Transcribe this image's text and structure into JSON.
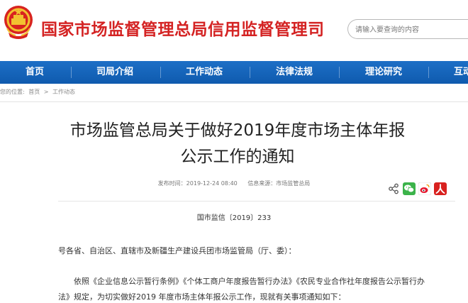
{
  "header": {
    "site_title": "国家市场监督管理总局信用监督管理司",
    "emblem_icon": "national-emblem-icon",
    "search": {
      "placeholder": "请输入要查询的内容"
    }
  },
  "nav": {
    "items": [
      {
        "label": "首页"
      },
      {
        "label": "司局介绍"
      },
      {
        "label": "工作动态"
      },
      {
        "label": "法律法规"
      },
      {
        "label": "理论研究"
      },
      {
        "label": "互动"
      }
    ],
    "background": "#1665bd"
  },
  "breadcrumb": {
    "prefix": "您的位置:",
    "items": [
      "首页",
      "工作动态"
    ],
    "separator": ">"
  },
  "article": {
    "title_line1": "市场监管总局关于做好2019年度市场主体年报",
    "title_line2": "公示工作的通知",
    "publish_time": "发布时间：2019-12-24 08:40",
    "source": "信息来源：市场监管总局",
    "share_icons": [
      "share-icon",
      "wechat-icon",
      "weibo-icon",
      "renren-icon"
    ],
    "doc_number": "国市监信〔2019〕233",
    "recipients": "号各省、自治区、直辖市及新疆生产建设兵团市场监管局（厅、委）：",
    "body_line1": "依照《企业信息公示暂行条例》《个体工商户年度报告暂行办法》《农民专业合作社年度报告公示暂行办",
    "body_line2": "法》规定，为切实做好2019 年度市场主体年报公示工作，现就有关事项通知如下："
  },
  "colors": {
    "title_red": "#d42323",
    "nav_blue": "#1665bd",
    "wechat_green": "#3bb34a",
    "weibo_red": "#e6162d",
    "renren_red": "#d8211f"
  }
}
